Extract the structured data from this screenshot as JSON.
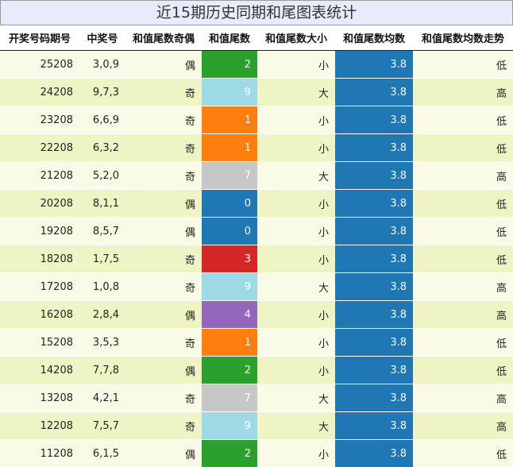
{
  "title": "近15期历史同期和尾图表统计",
  "chart_data": {
    "type": "table",
    "columns": [
      "开奖号码期号",
      "中奖号",
      "和值尾数奇偶",
      "和值尾数",
      "和值尾数大小",
      "和值尾数均数",
      "和值尾数均数走势"
    ],
    "rows": [
      {
        "period": "25208",
        "numbers": "3,0,9",
        "parity": "偶",
        "tail": 2,
        "size": "小",
        "avg": 3.8,
        "trend": "低"
      },
      {
        "period": "24208",
        "numbers": "9,7,3",
        "parity": "奇",
        "tail": 9,
        "size": "大",
        "avg": 3.8,
        "trend": "高"
      },
      {
        "period": "23208",
        "numbers": "6,6,9",
        "parity": "奇",
        "tail": 1,
        "size": "小",
        "avg": 3.8,
        "trend": "低"
      },
      {
        "period": "22208",
        "numbers": "6,3,2",
        "parity": "奇",
        "tail": 1,
        "size": "小",
        "avg": 3.8,
        "trend": "低"
      },
      {
        "period": "21208",
        "numbers": "5,2,0",
        "parity": "奇",
        "tail": 7,
        "size": "大",
        "avg": 3.8,
        "trend": "高"
      },
      {
        "period": "20208",
        "numbers": "8,1,1",
        "parity": "偶",
        "tail": 0,
        "size": "小",
        "avg": 3.8,
        "trend": "低"
      },
      {
        "period": "19208",
        "numbers": "8,5,7",
        "parity": "偶",
        "tail": 0,
        "size": "小",
        "avg": 3.8,
        "trend": "低"
      },
      {
        "period": "18208",
        "numbers": "1,7,5",
        "parity": "奇",
        "tail": 3,
        "size": "小",
        "avg": 3.8,
        "trend": "低"
      },
      {
        "period": "17208",
        "numbers": "1,0,8",
        "parity": "奇",
        "tail": 9,
        "size": "大",
        "avg": 3.8,
        "trend": "高"
      },
      {
        "period": "16208",
        "numbers": "2,8,4",
        "parity": "偶",
        "tail": 4,
        "size": "小",
        "avg": 3.8,
        "trend": "高"
      },
      {
        "period": "15208",
        "numbers": "3,5,3",
        "parity": "奇",
        "tail": 1,
        "size": "小",
        "avg": 3.8,
        "trend": "低"
      },
      {
        "period": "14208",
        "numbers": "7,7,8",
        "parity": "偶",
        "tail": 2,
        "size": "小",
        "avg": 3.8,
        "trend": "低"
      },
      {
        "period": "13208",
        "numbers": "4,2,1",
        "parity": "奇",
        "tail": 7,
        "size": "大",
        "avg": 3.8,
        "trend": "高"
      },
      {
        "period": "12208",
        "numbers": "7,5,7",
        "parity": "奇",
        "tail": 9,
        "size": "大",
        "avg": 3.8,
        "trend": "高"
      },
      {
        "period": "11208",
        "numbers": "6,1,5",
        "parity": "偶",
        "tail": 2,
        "size": "小",
        "avg": 3.8,
        "trend": "低"
      }
    ],
    "tail_colors": {
      "0": "#1f77b4",
      "1": "#ff7f0e",
      "2": "#2ca02c",
      "3": "#d62728",
      "4": "#9467bd",
      "7": "#c7c7c7",
      "9": "#9edae5"
    },
    "avg_color": "#1f77b4"
  }
}
